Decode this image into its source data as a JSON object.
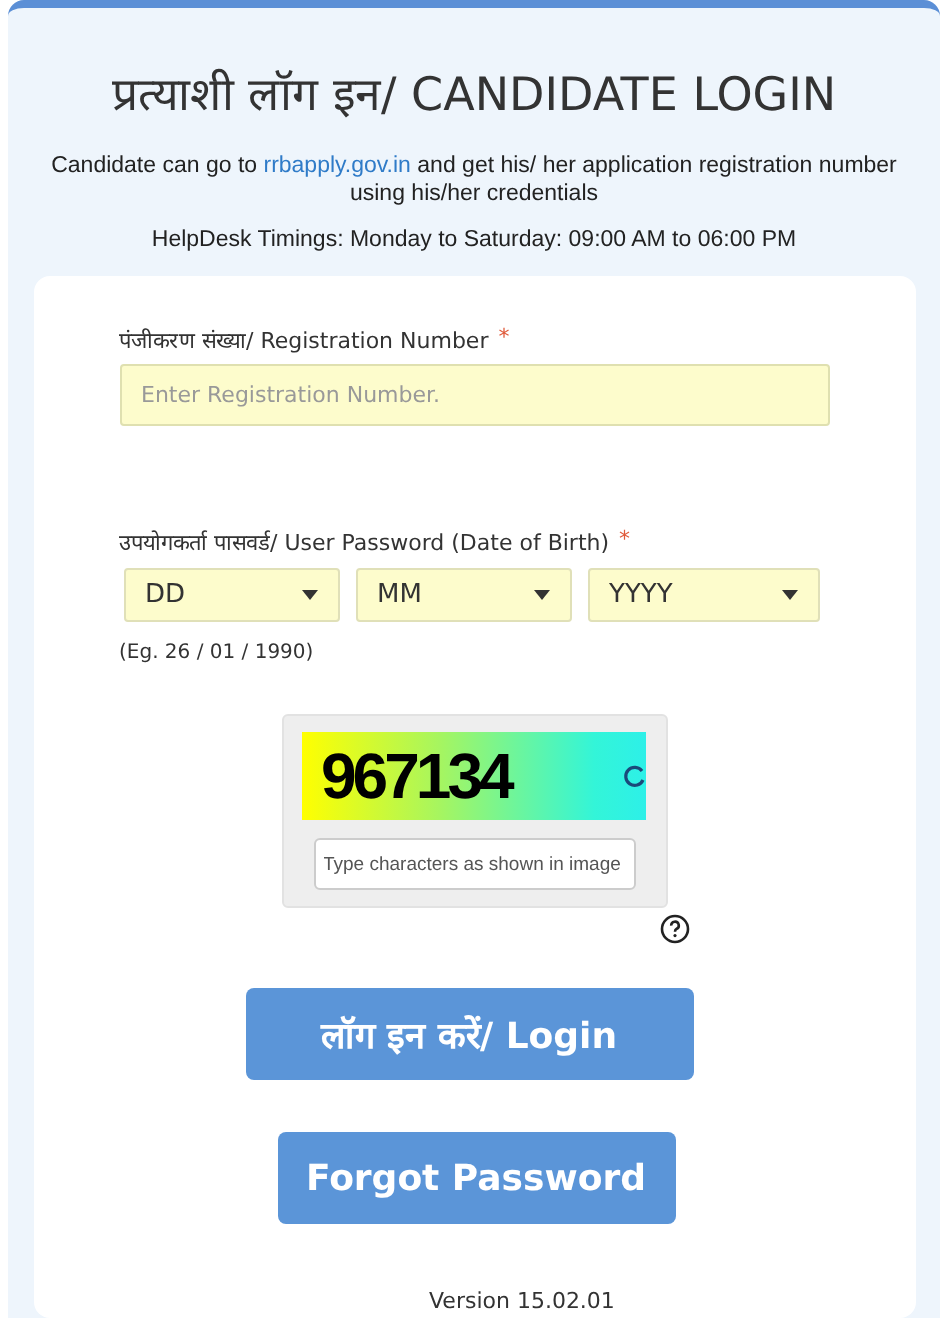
{
  "title": "प्रत्याशी लॉग इन/ CANDIDATE LOGIN",
  "info": {
    "before": "Candidate can go to",
    "link": "rrbapply.gov.in",
    "after": "and get his/ her application registration number using his/her credentials"
  },
  "helpdesk": "HelpDesk Timings: Monday to Saturday: 09:00 AM to 06:00 PM",
  "registration": {
    "label": "पंजीकरण संख्या/ Registration Number",
    "required": "*",
    "placeholder": "Enter Registration Number."
  },
  "password": {
    "label": "उपयोगकर्ता पासवर्ड/ User Password (Date of Birth)",
    "required": "*",
    "selects": [
      {
        "value": "DD"
      },
      {
        "value": "MM"
      },
      {
        "value": "YYYY"
      }
    ],
    "example": "(Eg. 26 / 01 / 1990)"
  },
  "captcha": {
    "code": "967134",
    "placeholder": "Type characters as shown in image"
  },
  "buttons": [
    {
      "label": "लॉग इन करें/ Login",
      "kind": "primary"
    },
    {
      "label": "Forgot Password",
      "kind": "secondary"
    }
  ],
  "version": "Version 15.02.01"
}
